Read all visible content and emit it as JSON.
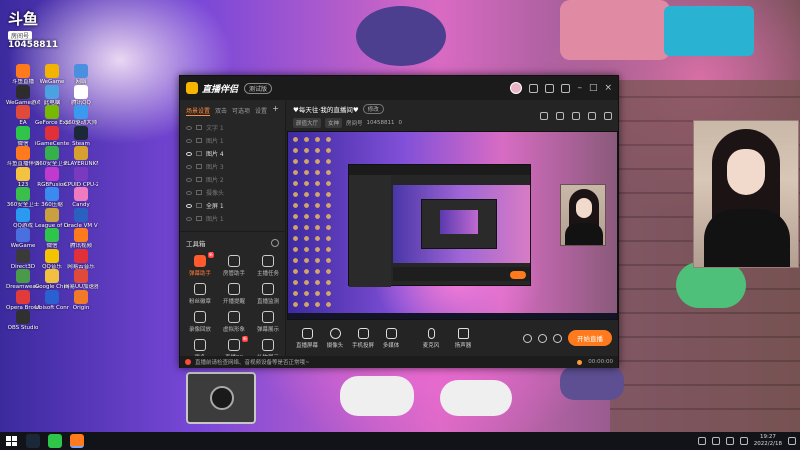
{
  "desktop": {
    "badge": {
      "big": "斗鱼",
      "tag": "房间号",
      "num": "10458811"
    },
    "icons": [
      {
        "label": "斗鱼直播",
        "color": "#ff7a1c"
      },
      {
        "label": "WeGame",
        "color": "#f2b400"
      },
      {
        "label": "网络",
        "color": "#4a8fe0"
      },
      {
        "label": "WeGame游戏",
        "color": "#2d2d2d"
      },
      {
        "label": "此电脑",
        "color": "#4aa3e0"
      },
      {
        "label": "腾讯QQ",
        "color": "#ffffff"
      },
      {
        "label": "EA",
        "color": "#e04a3a"
      },
      {
        "label": "GeForce Experience",
        "color": "#76b900"
      },
      {
        "label": "360驱动大师",
        "color": "#3a9af0"
      },
      {
        "label": "微信",
        "color": "#2ec54a"
      },
      {
        "label": "iGameCenter",
        "color": "#e0303a"
      },
      {
        "label": "Steam",
        "color": "#1b2838"
      },
      {
        "label": "斗鱼直播伴侣",
        "color": "#ff7a1c"
      },
      {
        "label": "360安全卫士",
        "color": "#36b04a"
      },
      {
        "label": "PLAYERUNKNOWN'S BATTLEGROUNDS",
        "color": "#d6a030"
      },
      {
        "label": "123",
        "color": "#f2c240"
      },
      {
        "label": "RGBFusion",
        "color": "#c03ad0"
      },
      {
        "label": "CPUID CPU-Z",
        "color": "#7a3ac0"
      },
      {
        "label": "360安全卫士",
        "color": "#3ac04a"
      },
      {
        "label": "360压缩",
        "color": "#3a8af0"
      },
      {
        "label": "Candy",
        "color": "#f07ac0"
      },
      {
        "label": "QQ游戏",
        "color": "#2a9af0"
      },
      {
        "label": "League of Legends",
        "color": "#c8a040"
      },
      {
        "label": "Oracle VM VirtualBox",
        "color": "#2a60c0"
      },
      {
        "label": "WeGame",
        "color": "#4a70e0"
      },
      {
        "label": "微信",
        "color": "#2ec54a"
      },
      {
        "label": "腾讯视频",
        "color": "#ff7a1c"
      },
      {
        "label": "Direct3D",
        "color": "#3a3a3a"
      },
      {
        "label": "QQ音乐",
        "color": "#f2c400"
      },
      {
        "label": "网易云音乐",
        "color": "#e0303a"
      },
      {
        "label": "Dreamweaver",
        "color": "#4a9a4a"
      },
      {
        "label": "Google Chrome",
        "color": "#f0c040"
      },
      {
        "label": "网易UU加速器",
        "color": "#e04a3a"
      },
      {
        "label": "Opera Browser",
        "color": "#e03a3a"
      },
      {
        "label": "Ubisoft Connect",
        "color": "#2a60d0"
      },
      {
        "label": "Origin",
        "color": "#f07a2a"
      },
      {
        "label": "OBS Studio",
        "color": "#303030"
      }
    ]
  },
  "app": {
    "brand": "直播伴侣",
    "version": "测试版",
    "left_tabs": [
      "场景设置",
      "双击",
      "可选项",
      "设置"
    ],
    "scenes": [
      {
        "label": "文字 1",
        "on": false
      },
      {
        "label": "图片 1",
        "on": false
      },
      {
        "label": "图片 4",
        "on": true
      },
      {
        "label": "图片 3",
        "on": false
      },
      {
        "label": "图片 2",
        "on": false
      },
      {
        "label": "摄像头",
        "on": false
      },
      {
        "label": "全屏 1",
        "on": true
      },
      {
        "label": "图片 1",
        "on": false
      }
    ],
    "tools_title": "工具箱",
    "tools": [
      {
        "label": "弹幕助手",
        "hot": true,
        "badge": "新"
      },
      {
        "label": "房管助手",
        "hot": false,
        "badge": ""
      },
      {
        "label": "主播任务",
        "hot": false,
        "badge": ""
      },
      {
        "label": "粉丝徽章",
        "hot": false,
        "badge": ""
      },
      {
        "label": "开播提醒",
        "hot": false,
        "badge": ""
      },
      {
        "label": "直播监测",
        "hot": false,
        "badge": ""
      },
      {
        "label": "录像回放",
        "hot": false,
        "badge": ""
      },
      {
        "label": "虚拟形象",
        "hot": false,
        "badge": ""
      },
      {
        "label": "弹幕展示",
        "hot": false,
        "badge": ""
      },
      {
        "label": "更多",
        "hot": false,
        "badge": ""
      },
      {
        "label": "直播PK",
        "hot": false,
        "badge": "新"
      },
      {
        "label": "礼物展示",
        "hot": false,
        "badge": ""
      }
    ],
    "stream": {
      "title": "♥每天往·我的直播间♥",
      "title_pill": "修改",
      "category": "颜值大厅",
      "subcategory": "女神",
      "room_label": "房间号",
      "room_id": "10458811",
      "viewers": "0"
    },
    "controls": [
      {
        "label": "直播屏幕"
      },
      {
        "label": "摄像头"
      },
      {
        "label": "手机投屏"
      },
      {
        "label": "多媒体"
      },
      {
        "label": "麦克风"
      },
      {
        "label": "扬声器"
      }
    ],
    "go_live": "开始直播",
    "status": {
      "message": "直播前请检查网络、音视频设备等是否正常哦~",
      "timer": "00:00:00"
    }
  },
  "taskbar": {
    "time": "19:27",
    "date": "2022/2/18",
    "pins": [
      {
        "name": "steam",
        "color": "#1b2838"
      },
      {
        "name": "wechat",
        "color": "#2ec54a"
      },
      {
        "name": "douyu-live",
        "color": "#ff7a1c"
      }
    ]
  },
  "colors": {
    "accent": "#ff7a1c",
    "live_button": "#ff7a1c",
    "panel": "#242424"
  }
}
